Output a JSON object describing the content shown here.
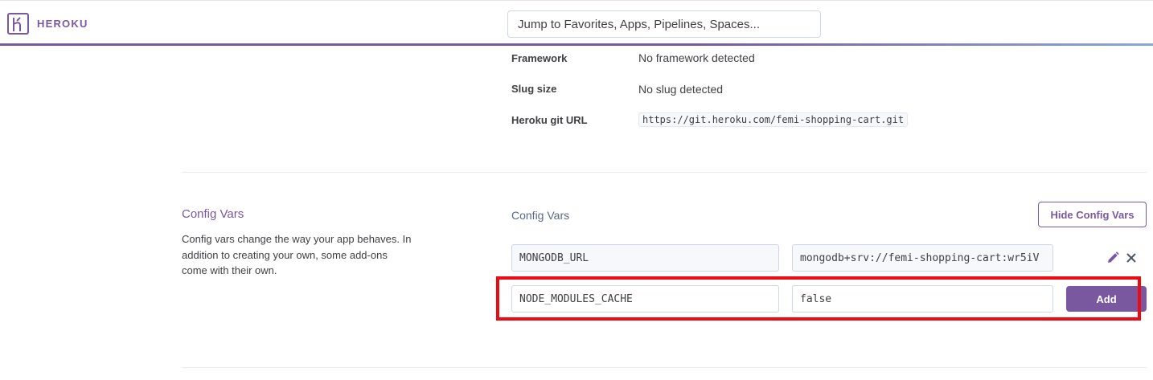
{
  "header": {
    "brand": "HEROKU",
    "search_placeholder": "Jump to Favorites, Apps, Pipelines, Spaces..."
  },
  "info": {
    "framework_label": "Framework",
    "framework_value": "No framework detected",
    "slug_label": "Slug size",
    "slug_value": "No slug detected",
    "git_label": "Heroku git URL",
    "git_value": "https://git.heroku.com/femi-shopping-cart.git"
  },
  "config_vars": {
    "title": "Config Vars",
    "description": "Config vars change the way your app behaves. In addition to creating your own, some add-ons come with their own.",
    "heading": "Config Vars",
    "hide_button": "Hide Config Vars",
    "existing": [
      {
        "key": "MONGODB_URL",
        "value": "mongodb+srv://femi-shopping-cart:wr5iV"
      }
    ],
    "new_key": "NODE_MODULES_CACHE",
    "new_value": "false",
    "add_button": "Add"
  },
  "colors": {
    "brand": "#79589f",
    "highlight": "#ee0a12"
  }
}
